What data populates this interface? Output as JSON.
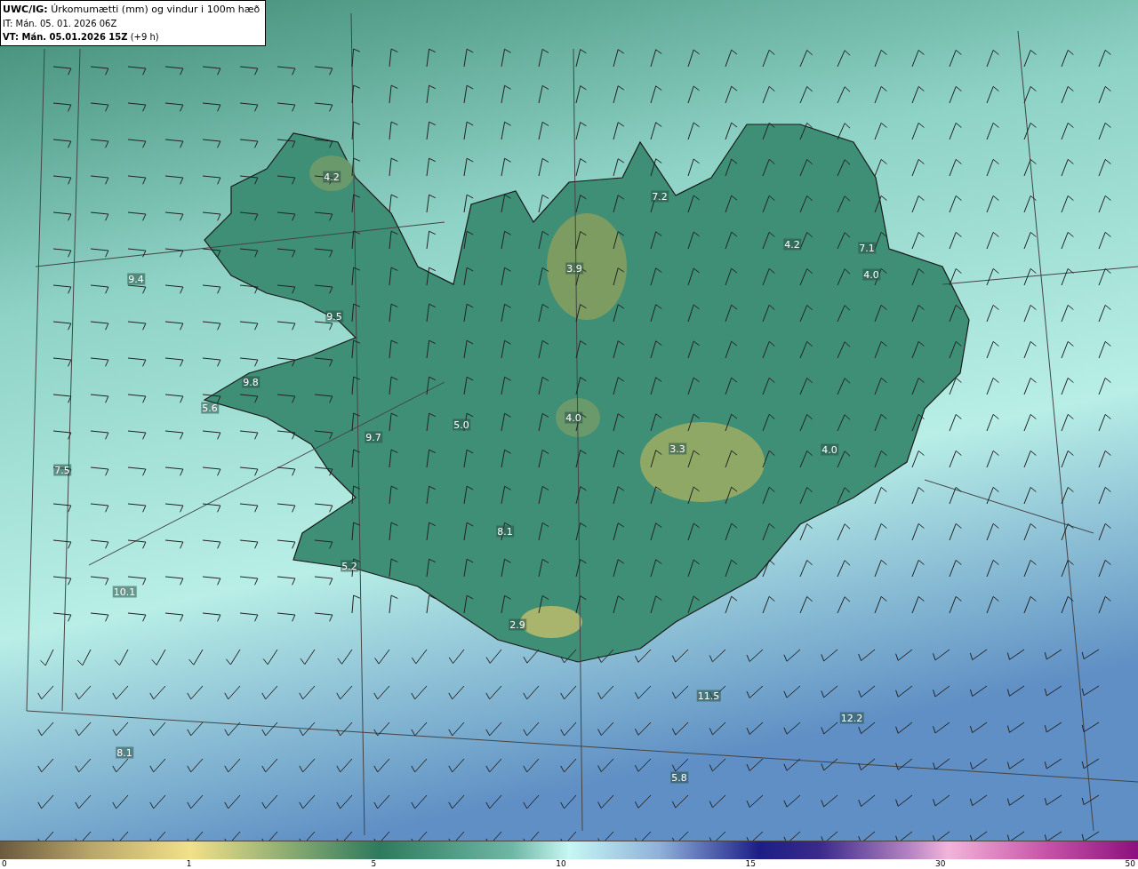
{
  "header": {
    "title": "**UWC/IG:** Úrkomumætti (mm) og vindur i 100m hæð",
    "issue_time": "IT: Mán. 05. 01. 2026 06Z",
    "valid_time": "**VT: Mán. 05.01.2026 15Z** (+9 h)"
  },
  "map_labels": [
    {
      "text": "4.2"
    },
    {
      "text": "7.2"
    },
    {
      "text": "4.2"
    },
    {
      "text": "7.1"
    },
    {
      "text": "4.0"
    },
    {
      "text": "3.9"
    },
    {
      "text": "9.4"
    },
    {
      "text": "9.5"
    },
    {
      "text": "9.8"
    },
    {
      "text": "5.6"
    },
    {
      "text": "5.0"
    },
    {
      "text": "4.0"
    },
    {
      "text": "9.7"
    },
    {
      "text": "7.5"
    },
    {
      "text": "3.3"
    },
    {
      "text": "4.0"
    },
    {
      "text": "8.1"
    },
    {
      "text": "5.2"
    },
    {
      "text": "10.1"
    },
    {
      "text": "2.9"
    },
    {
      "text": "8.1"
    },
    {
      "text": "11.5"
    },
    {
      "text": "12.2"
    },
    {
      "text": "5.8"
    }
  ],
  "colorbar": {
    "ticks": [
      "0",
      "1",
      "5",
      "10",
      "15",
      "30",
      "50"
    ]
  }
}
